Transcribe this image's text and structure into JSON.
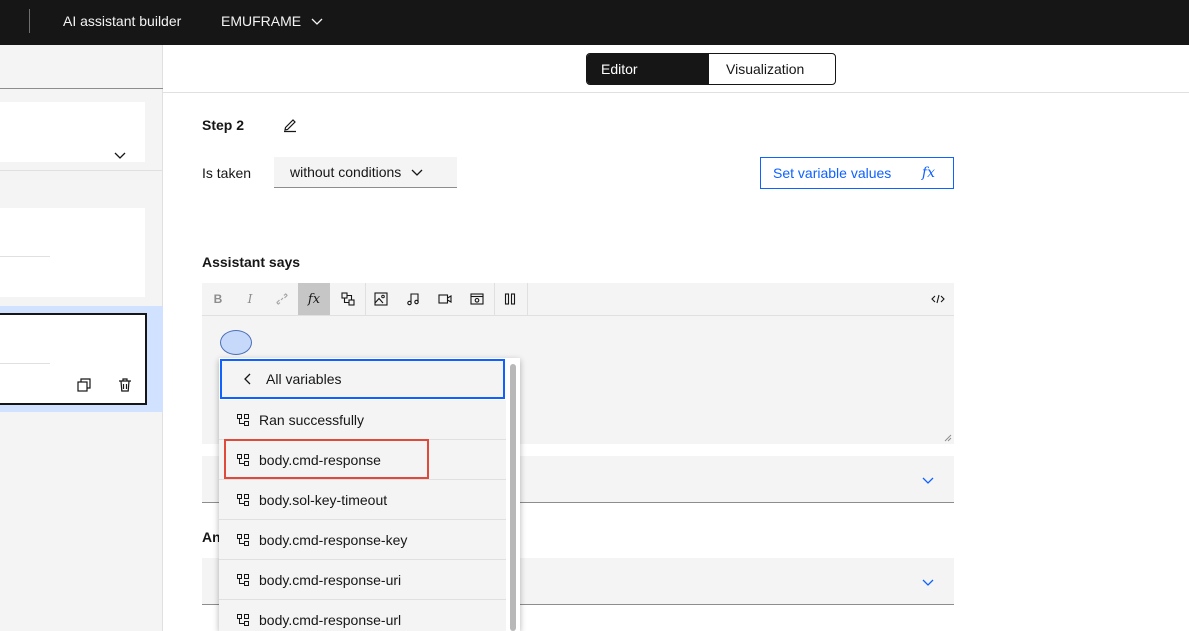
{
  "topbar": {
    "app_title": "AI assistant builder",
    "workspace": "EMUFRAME"
  },
  "view_toggle": {
    "editor": "Editor",
    "visualization": "Visualization",
    "selected": "Editor"
  },
  "step": {
    "title": "Step 2",
    "is_taken_label": "Is taken",
    "condition_value": "without conditions",
    "set_variable_label": "Set variable values",
    "fx_symbol": "fx"
  },
  "assistant_says": {
    "label": "Assistant says",
    "toolbar": {
      "bold": "B",
      "italic": "I"
    }
  },
  "partial_section_label": "An",
  "variable_menu": {
    "header": "All variables",
    "items": [
      "Ran successfully",
      "body.cmd-response",
      "body.sol-key-timeout",
      "body.cmd-response-key",
      "body.cmd-response-uri",
      "body.cmd-response-url"
    ],
    "highlighted": "body.cmd-response"
  },
  "colors": {
    "accent": "#0f62fe",
    "highlight": "#e04a3a",
    "topbar": "#161616",
    "selected_bg": "#d0e2ff"
  }
}
